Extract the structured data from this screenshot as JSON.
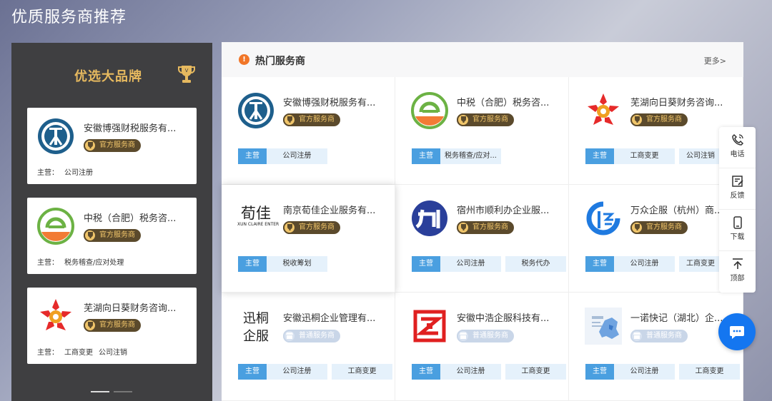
{
  "page": {
    "title": "优质服务商推荐"
  },
  "brand_panel": {
    "title": "优选大品牌",
    "cards": [
      {
        "name": "安徽博强财税服务有...",
        "badge": "官方服务商",
        "main_label": "主营：",
        "services": [
          "公司注册"
        ]
      },
      {
        "name": "中税（合肥）税务咨...",
        "badge": "官方服务商",
        "main_label": "主营：",
        "services": [
          "税务稽查/应对处理"
        ]
      },
      {
        "name": "芜湖向日葵财务咨询...",
        "badge": "官方服务商",
        "main_label": "主营：",
        "services": [
          "工商变更",
          "公司注销"
        ]
      }
    ]
  },
  "hot_panel": {
    "title": "热门服务商",
    "more": "更多>",
    "main_tag": "主营",
    "providers": [
      {
        "name": "安徽博强财税服务有...",
        "badge": "官方服务商",
        "badge_type": "official",
        "tags": [
          "公司注册"
        ]
      },
      {
        "name": "中税（合肥）税务咨...",
        "badge": "官方服务商",
        "badge_type": "official",
        "tags": [
          "税务稽查/应对..."
        ]
      },
      {
        "name": "芜湖向日葵财务咨询...",
        "badge": "官方服务商",
        "badge_type": "official",
        "tags": [
          "工商变更",
          "公司注销"
        ]
      },
      {
        "name": "南京荀佳企业服务有...",
        "badge": "官方服务商",
        "badge_type": "official",
        "tags": [
          "税收筹划"
        ],
        "logo_text": "荀佳",
        "logo_sub": "XUN CLAIRE ENTER"
      },
      {
        "name": "宿州市顺利办企业服...",
        "badge": "官方服务商",
        "badge_type": "official",
        "tags": [
          "公司注册",
          "税务代办"
        ]
      },
      {
        "name": "万众企服（杭州）商...",
        "badge": "官方服务商",
        "badge_type": "official",
        "tags": [
          "公司注册",
          "工商变更"
        ]
      },
      {
        "name": "安徽迅桐企业管理有...",
        "badge": "普通服务商",
        "badge_type": "normal",
        "tags": [
          "公司注册",
          "工商变更"
        ],
        "logo_text1": "迅桐",
        "logo_text2": "企服"
      },
      {
        "name": "安徽中浩企服科技有...",
        "badge": "普通服务商",
        "badge_type": "normal",
        "tags": [
          "公司注册",
          "工商变更"
        ]
      },
      {
        "name": "一诺快记（湖北）企...",
        "badge": "普通服务商",
        "badge_type": "normal",
        "tags": [
          "公司注册",
          "工商变更"
        ]
      }
    ]
  },
  "side_bar": {
    "items": [
      {
        "label": "电话",
        "icon": "phone-icon"
      },
      {
        "label": "反馈",
        "icon": "feedback-icon"
      },
      {
        "label": "下载",
        "icon": "mobile-icon"
      },
      {
        "label": "顶部",
        "icon": "back-to-top-icon"
      }
    ]
  },
  "colors": {
    "accent": "#1476f0",
    "tag_blue": "#4a9fe0",
    "gold": "#e6b95f",
    "panel_dark": "#3f3f41"
  }
}
